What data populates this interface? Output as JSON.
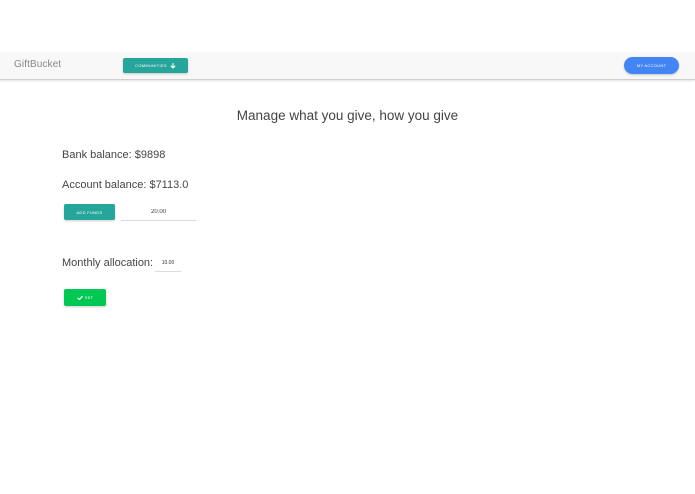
{
  "navbar": {
    "brand": "GiftBucket",
    "communities_label": "COMMUNITIES",
    "communities_icon": "arrow-down-icon",
    "account_label": "MY ACCOUNT"
  },
  "main": {
    "headline": "Manage what you give, how you give",
    "bank_balance": "Bank balance: $9898",
    "account_balance": "Account balance: $7113.0",
    "add_funds_label": "ADD FUNDS",
    "add_funds_value": "20.00",
    "allocation_label": "Monthly allocation:",
    "allocation_value": "10.00",
    "set_label": "SET",
    "set_icon": "check-icon"
  },
  "colors": {
    "teal": "#26a69a",
    "blue": "#4285f4",
    "green": "#00c853"
  }
}
